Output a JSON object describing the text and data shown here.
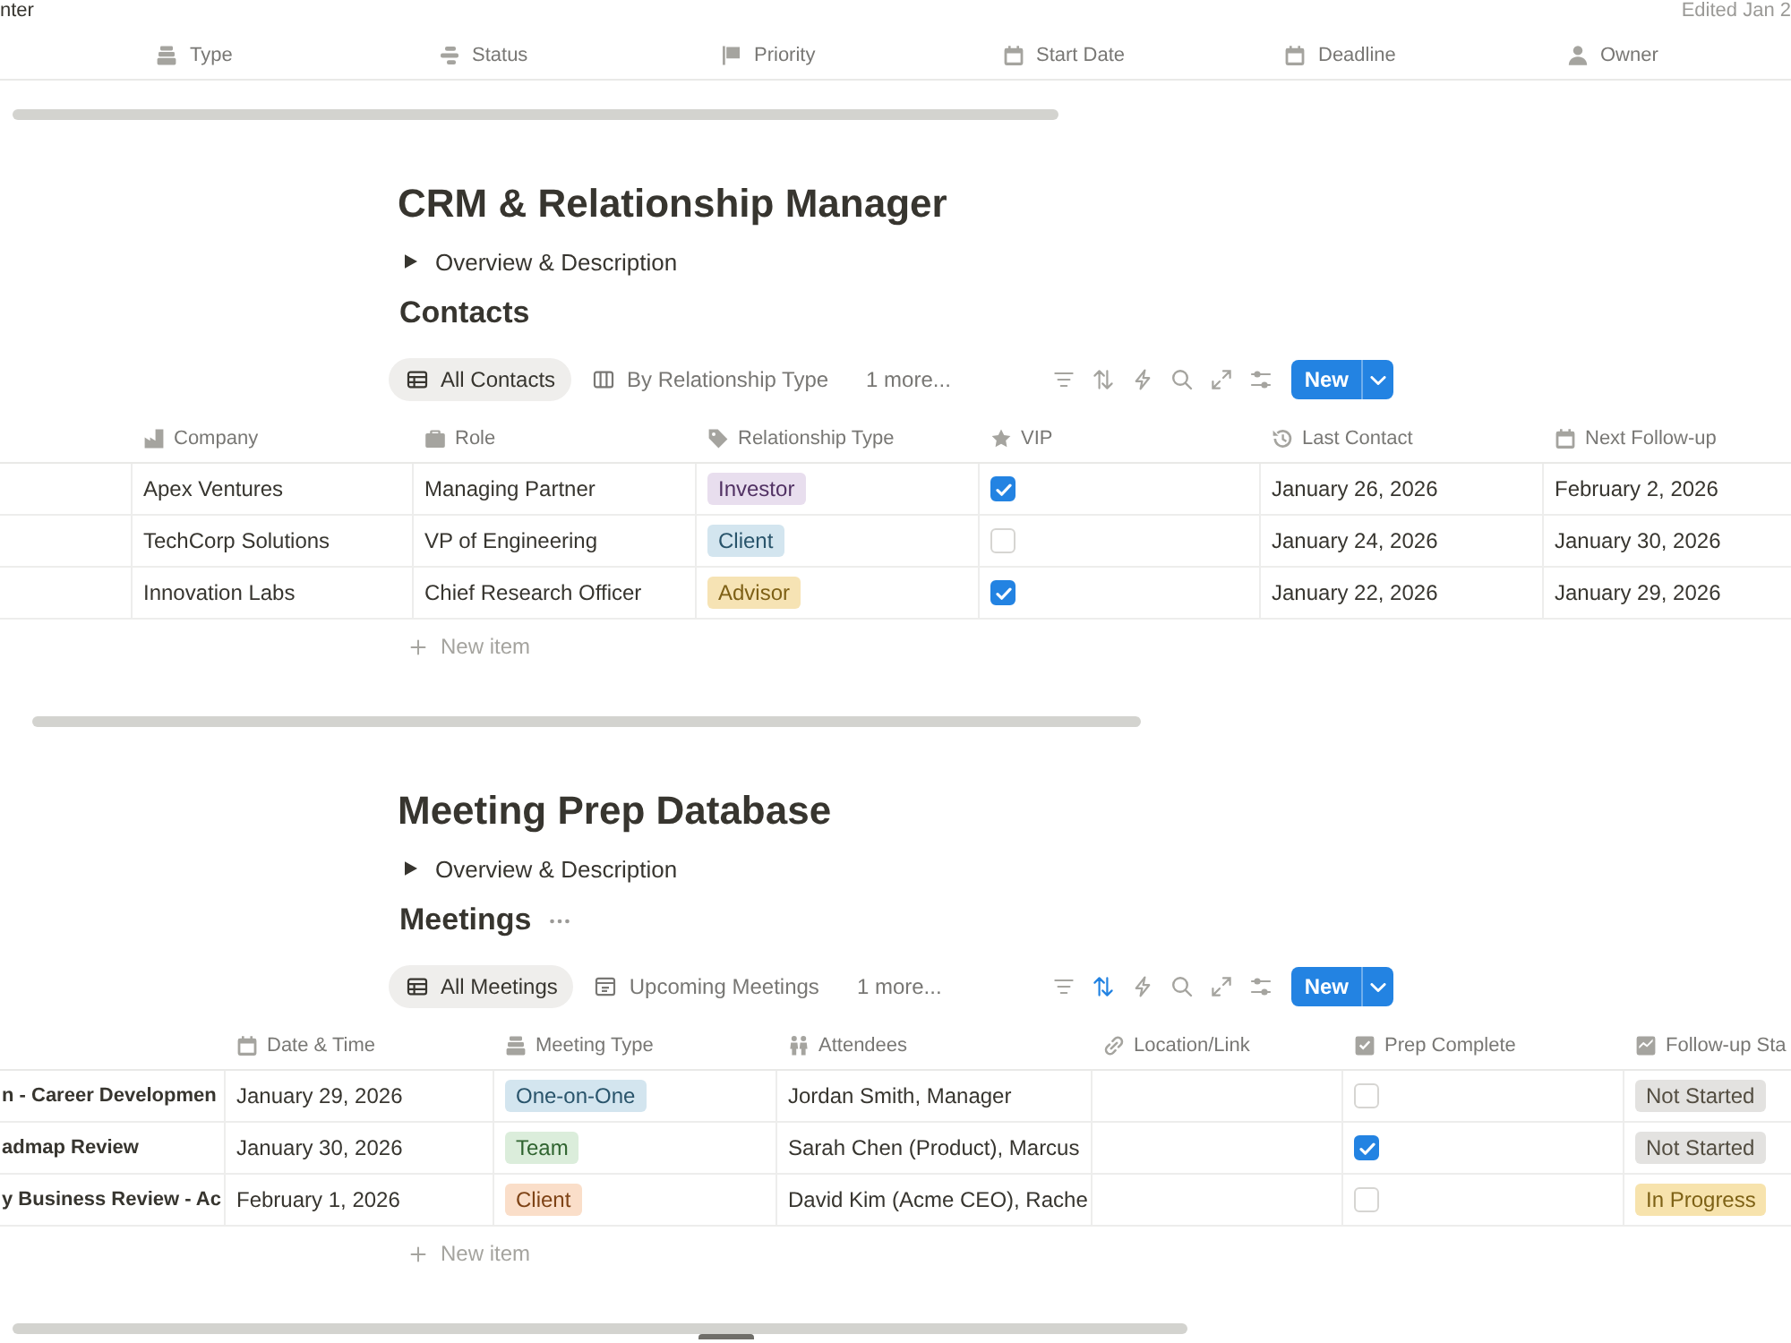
{
  "top_bar": {
    "breadcrumb": "nter",
    "edited": "Edited Jan 2"
  },
  "property_header": [
    "Type",
    "Status",
    "Priority",
    "Start Date",
    "Deadline",
    "Owner"
  ],
  "sections": [
    {
      "title": "CRM & Relationship Manager",
      "toggle": {
        "label": "Overview & Description",
        "expanded": false
      },
      "heading": "Contacts",
      "heading_more": false,
      "tabs": [
        {
          "label": "All Contacts",
          "kind": "table",
          "selected": true
        },
        {
          "label": "By Relationship Type",
          "kind": "board",
          "selected": false
        }
      ],
      "more_views": "1 more...",
      "sort_active": false,
      "new_button": "New",
      "table": {
        "columns": [
          {
            "label": "Company",
            "kind": "text"
          },
          {
            "label": "Role",
            "kind": "text"
          },
          {
            "label": "Relationship Type",
            "kind": "tag"
          },
          {
            "label": "VIP",
            "kind": "checkbox"
          },
          {
            "label": "Last Contact",
            "kind": "text"
          },
          {
            "label": "Next Follow-up",
            "kind": "text"
          }
        ],
        "rows": [
          {
            "cells": [
              "Apex Ventures",
              "Managing Partner",
              {
                "label": "Investor",
                "color": "#e8deee"
              },
              {
                "checked": true
              },
              "January 26, 2026",
              "February 2, 2026"
            ]
          },
          {
            "cells": [
              "TechCorp Solutions",
              "VP of Engineering",
              {
                "label": "Client",
                "color": "#d3e5ef"
              },
              {
                "checked": false
              },
              "January 24, 2026",
              "January 30, 2026"
            ]
          },
          {
            "cells": [
              "Innovation Labs",
              "Chief Research Officer",
              {
                "label": "Advisor",
                "color": "#f6e3b4"
              },
              {
                "checked": true
              },
              "January 22, 2026",
              "January 29, 2026"
            ]
          }
        ]
      },
      "new_item": "New item"
    },
    {
      "title": "Meeting Prep Database",
      "toggle": {
        "label": "Overview & Description",
        "expanded": false
      },
      "heading": "Meetings",
      "heading_more": true,
      "tabs": [
        {
          "label": "All Meetings",
          "kind": "table",
          "selected": true
        },
        {
          "label": "Upcoming Meetings",
          "kind": "calendar",
          "selected": false
        }
      ],
      "more_views": "1 more...",
      "sort_active": true,
      "new_button": "New",
      "table": {
        "columns": [
          {
            "kind": "title"
          },
          {
            "label": "Date & Time",
            "kind": "text"
          },
          {
            "label": "Meeting Type",
            "kind": "tag"
          },
          {
            "label": "Attendees",
            "kind": "text"
          },
          {
            "label": "Location/Link",
            "kind": "url"
          },
          {
            "label": "Prep Complete",
            "kind": "checkbox"
          },
          {
            "label": "Follow-up Sta",
            "kind": "tag"
          }
        ],
        "rows": [
          {
            "cells": [
              "n - Career Developmen",
              "January 29, 2026",
              {
                "label": "One-on-One",
                "color": "#d3e5ef"
              },
              "Jordan Smith, Manager",
              null,
              {
                "checked": false
              },
              {
                "label": "Not Started",
                "color": "#e3e2e0"
              }
            ]
          },
          {
            "cells": [
              "admap Review",
              "January 30, 2026",
              {
                "label": "Team",
                "color": "#dbeddb"
              },
              "Sarah Chen (Product), Marcus",
              null,
              {
                "checked": true
              },
              {
                "label": "Not Started",
                "color": "#e3e2e0"
              }
            ]
          },
          {
            "cells": [
              "y Business Review - Ac",
              "February 1, 2026",
              {
                "label": "Client",
                "color": "#fadec9"
              },
              "David Kim (Acme CEO), Rache",
              null,
              {
                "checked": false
              },
              {
                "label": "In Progress",
                "color": "#f7e3ad"
              }
            ]
          }
        ]
      },
      "new_item": "New item"
    }
  ]
}
